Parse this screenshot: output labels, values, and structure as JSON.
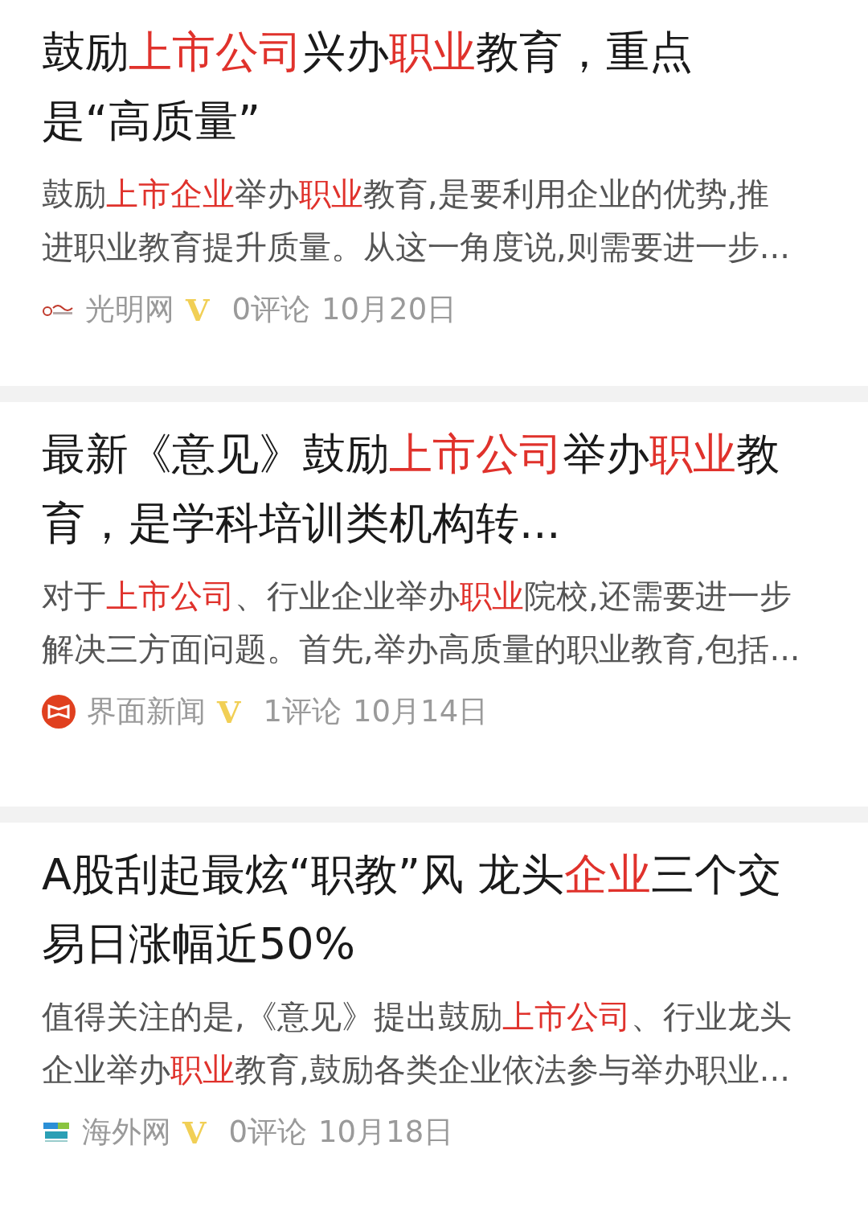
{
  "articles": [
    {
      "title": [
        [
          {
            "text": "鼓励",
            "highlight": false
          },
          {
            "text": "上市公司",
            "highlight": true
          },
          {
            "text": "兴办",
            "highlight": false
          },
          {
            "text": "职业",
            "highlight": true
          },
          {
            "text": "教育，重点",
            "highlight": false
          }
        ],
        [
          {
            "text": "是“高质量”",
            "highlight": false
          }
        ]
      ],
      "snippet": [
        [
          {
            "text": "鼓励",
            "highlight": false
          },
          {
            "text": "上市企业",
            "highlight": true
          },
          {
            "text": "举办",
            "highlight": false
          },
          {
            "text": "职业",
            "highlight": true
          },
          {
            "text": "教育,是要利用企业的优势,推",
            "highlight": false
          }
        ],
        [
          {
            "text": "进职业教育提升质量。从这一角度说,则需要进一步...",
            "highlight": false
          }
        ]
      ],
      "source": {
        "name": "光明网",
        "kind": "gmw",
        "badge": "V"
      },
      "comments": "0评论",
      "date": "10月20日"
    },
    {
      "title": [
        [
          {
            "text": "最新《意见》鼓励",
            "highlight": false
          },
          {
            "text": "上市公司",
            "highlight": true
          },
          {
            "text": "举办",
            "highlight": false
          },
          {
            "text": "职业",
            "highlight": true
          },
          {
            "text": "教",
            "highlight": false
          }
        ],
        [
          {
            "text": "育，是学科培训类机构转...",
            "highlight": false
          }
        ]
      ],
      "snippet": [
        [
          {
            "text": "对于",
            "highlight": false
          },
          {
            "text": "上市公司",
            "highlight": true
          },
          {
            "text": "、行业企业举办",
            "highlight": false
          },
          {
            "text": "职业",
            "highlight": true
          },
          {
            "text": "院校,还需要进一步",
            "highlight": false
          }
        ],
        [
          {
            "text": "解决三方面问题。首先,举办高质量的职业教育,包括...",
            "highlight": false
          }
        ]
      ],
      "source": {
        "name": "界面新闻",
        "kind": "jiemian",
        "badge": "V"
      },
      "comments": "1评论",
      "date": "10月14日"
    },
    {
      "title": [
        [
          {
            "text": "A股刮起最炫“职教”风 龙头",
            "highlight": false
          },
          {
            "text": "企业",
            "highlight": true
          },
          {
            "text": "三个交",
            "highlight": false
          }
        ],
        [
          {
            "text": "易日涨幅近50%",
            "highlight": false
          }
        ]
      ],
      "snippet": [
        [
          {
            "text": "值得关注的是,《意见》提出鼓励",
            "highlight": false
          },
          {
            "text": "上市公司",
            "highlight": true
          },
          {
            "text": "、行业龙头",
            "highlight": false
          }
        ],
        [
          {
            "text": "企业举办",
            "highlight": false
          },
          {
            "text": "职业",
            "highlight": true
          },
          {
            "text": "教育,鼓励各类企业依法参与举办职业...",
            "highlight": false
          }
        ]
      ],
      "source": {
        "name": "海外网",
        "kind": "haiwai",
        "badge": "V"
      },
      "comments": "0评论",
      "date": "10月18日"
    }
  ]
}
